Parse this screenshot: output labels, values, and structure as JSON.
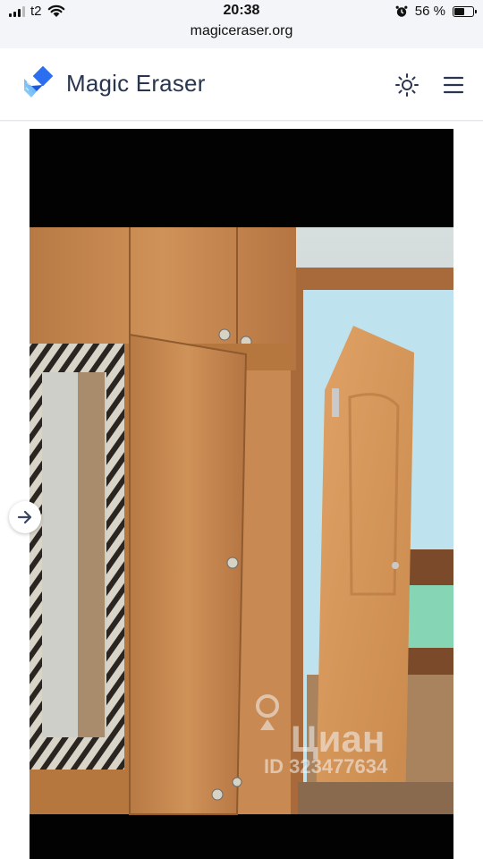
{
  "status_bar": {
    "carrier": "t2",
    "time": "20:38",
    "battery_percent": "56 %",
    "battery_level": 0.56,
    "url": "magiceraser.org"
  },
  "header": {
    "title": "Magic Eraser",
    "theme_toggle_icon": "sun-icon",
    "menu_icon": "hamburger-menu-icon"
  },
  "image": {
    "watermark_brand": "Циан",
    "watermark_id": "ID 323477634",
    "nav_icon": "arrow-right-icon"
  },
  "colors": {
    "brand_text": "#2a3550",
    "logo_blue": "#2b6ff0",
    "logo_light": "#79c3f5"
  }
}
